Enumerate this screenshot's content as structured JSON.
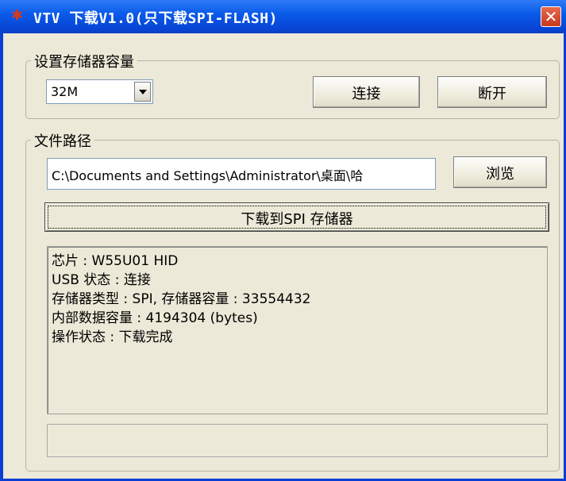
{
  "window": {
    "title": "VTV 下载V1.0(只下载SPI-FLASH)",
    "close_symbol": "✕"
  },
  "capacity_group": {
    "label": "设置存储器容量",
    "selected": "32M",
    "connect_label": "连接",
    "disconnect_label": "断开"
  },
  "file_group": {
    "label": "文件路径",
    "path_value": "C:\\Documents and Settings\\Administrator\\桌面\\哈",
    "browse_label": "浏览",
    "download_label": "下载到SPI 存储器"
  },
  "status": {
    "lines": [
      "芯片 : W55U01 HID",
      "USB 状态 : 连接",
      "存储器类型 : SPI, 存储器容量 : 33554432",
      "内部数据容量 : 4194304 (bytes)",
      "操作状态 : 下载完成"
    ]
  },
  "progress": {
    "value": 0
  },
  "colors": {
    "titlebar": "#0b5bea",
    "window_bg": "#ece9d8",
    "close": "#c9391e"
  }
}
